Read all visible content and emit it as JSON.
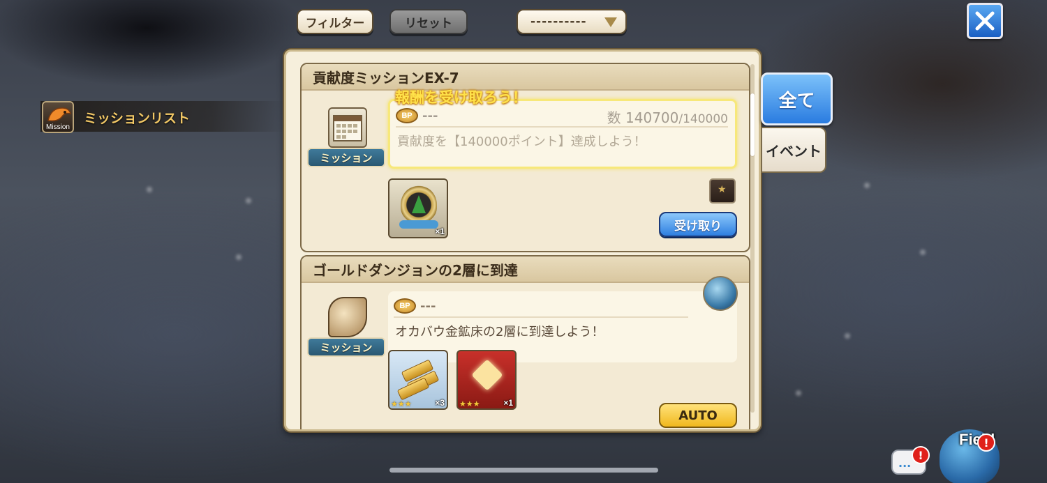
{
  "toolbar": {
    "filter_label": "フィルター",
    "reset_label": "リセット",
    "dropdown_value": "----------"
  },
  "sidebar": {
    "icon_caption": "Mission",
    "title": "ミッションリスト"
  },
  "tabs": {
    "all_label": "全て",
    "event_label": "イベント"
  },
  "missions": [
    {
      "title": "貢献度ミッションEX-7",
      "badge_label": "ミッション",
      "bp_icon": "BP",
      "bp_value": "---",
      "count_prefix": "数",
      "count_current": "140700",
      "count_target": "/140000",
      "description": "貢献度を【140000ポイント】達成しよう！",
      "overlay_message": "報酬を受け取ろう！",
      "reward_count": "×1",
      "action_label": "受け取り"
    },
    {
      "title": "ゴールドダンジョンの2層に到達",
      "badge_label": "ミッション",
      "bp_icon": "BP",
      "bp_value": "---",
      "description": "オカバウ金鉱床の2層に到達しよう！",
      "rewards": [
        {
          "stars": "★★★",
          "count": "×3"
        },
        {
          "stars": "★★★",
          "count": "×1"
        }
      ],
      "action_label": "AUTO"
    }
  ],
  "bottom": {
    "field_label": "Field",
    "alert_symbol": "!",
    "chat_dots": "..."
  },
  "colors": {
    "accent_blue": "#2e7fe0",
    "panel_bg": "#f6efdc",
    "highlight_yellow": "#ffe24a",
    "auto_yellow": "#f0b81e"
  }
}
